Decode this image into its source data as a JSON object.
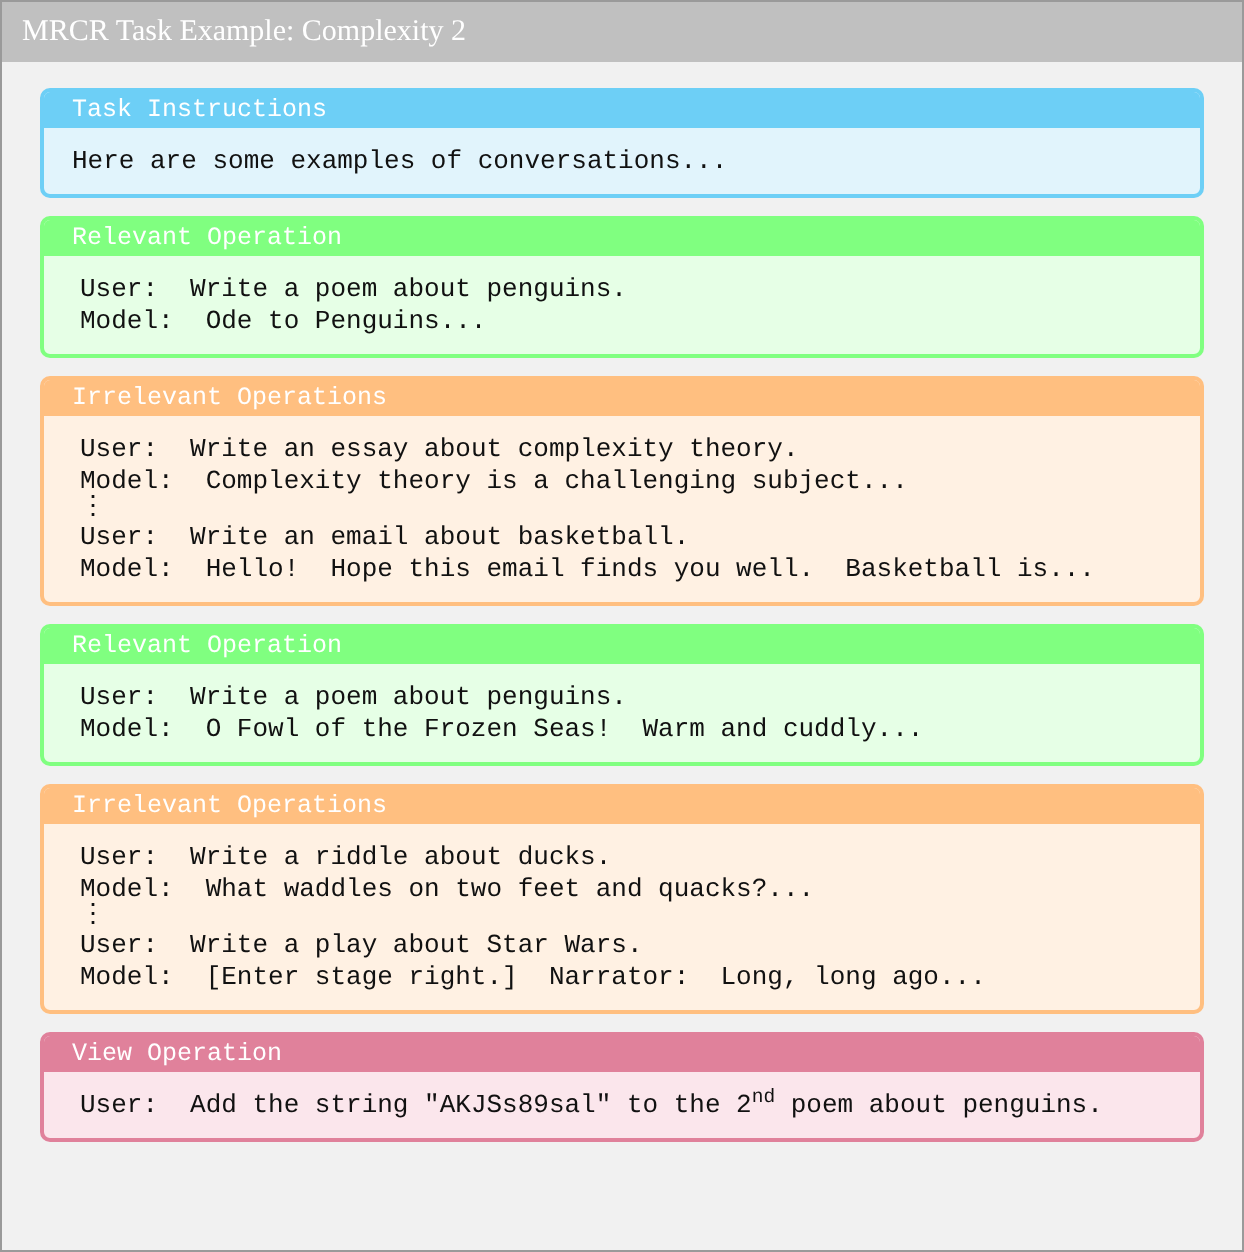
{
  "window": {
    "title": "MRCR Task Example: Complexity 2"
  },
  "sections": [
    {
      "kind": "task",
      "title": "Task Instructions",
      "lines": [
        {
          "kind": "text",
          "text": "Here are some examples of conversations..."
        }
      ]
    },
    {
      "kind": "relevant",
      "title": "Relevant Operation",
      "lines": [
        {
          "kind": "turn",
          "speaker": "User:",
          "text": "Write a poem about penguins."
        },
        {
          "kind": "turn",
          "speaker": "Model:",
          "text": "Ode to Penguins..."
        }
      ]
    },
    {
      "kind": "irrelevant",
      "title": "Irrelevant Operations",
      "lines": [
        {
          "kind": "turn",
          "speaker": "User:",
          "text": "Write an essay about complexity theory."
        },
        {
          "kind": "turn",
          "speaker": "Model:",
          "text": "Complexity theory is a challenging subject..."
        },
        {
          "kind": "gap",
          "text": "⋮"
        },
        {
          "kind": "turn",
          "speaker": "User:",
          "text": "Write an email about basketball."
        },
        {
          "kind": "turn",
          "speaker": "Model:",
          "text": "Hello!  Hope this email finds you well.  Basketball is..."
        }
      ]
    },
    {
      "kind": "relevant",
      "title": "Relevant Operation",
      "lines": [
        {
          "kind": "turn",
          "speaker": "User:",
          "text": "Write a poem about penguins."
        },
        {
          "kind": "turn",
          "speaker": "Model:",
          "text": "O Fowl of the Frozen Seas!  Warm and cuddly..."
        }
      ]
    },
    {
      "kind": "irrelevant",
      "title": "Irrelevant Operations",
      "lines": [
        {
          "kind": "turn",
          "speaker": "User:",
          "text": "Write a riddle about ducks."
        },
        {
          "kind": "turn",
          "speaker": "Model:",
          "text": "What waddles on two feet and quacks?..."
        },
        {
          "kind": "gap",
          "text": "⋮"
        },
        {
          "kind": "turn",
          "speaker": "User:",
          "text": "Write a play about Star Wars."
        },
        {
          "kind": "turn",
          "speaker": "Model:",
          "text": "[Enter stage right.]  Narrator:  Long, long ago..."
        }
      ]
    },
    {
      "kind": "view",
      "title": "View Operation",
      "lines": [
        {
          "kind": "turn",
          "speaker": "User:",
          "text": "Add the string \"AKJSs89sal\" to the 2$^{nd}$ poem about penguins."
        }
      ]
    }
  ]
}
